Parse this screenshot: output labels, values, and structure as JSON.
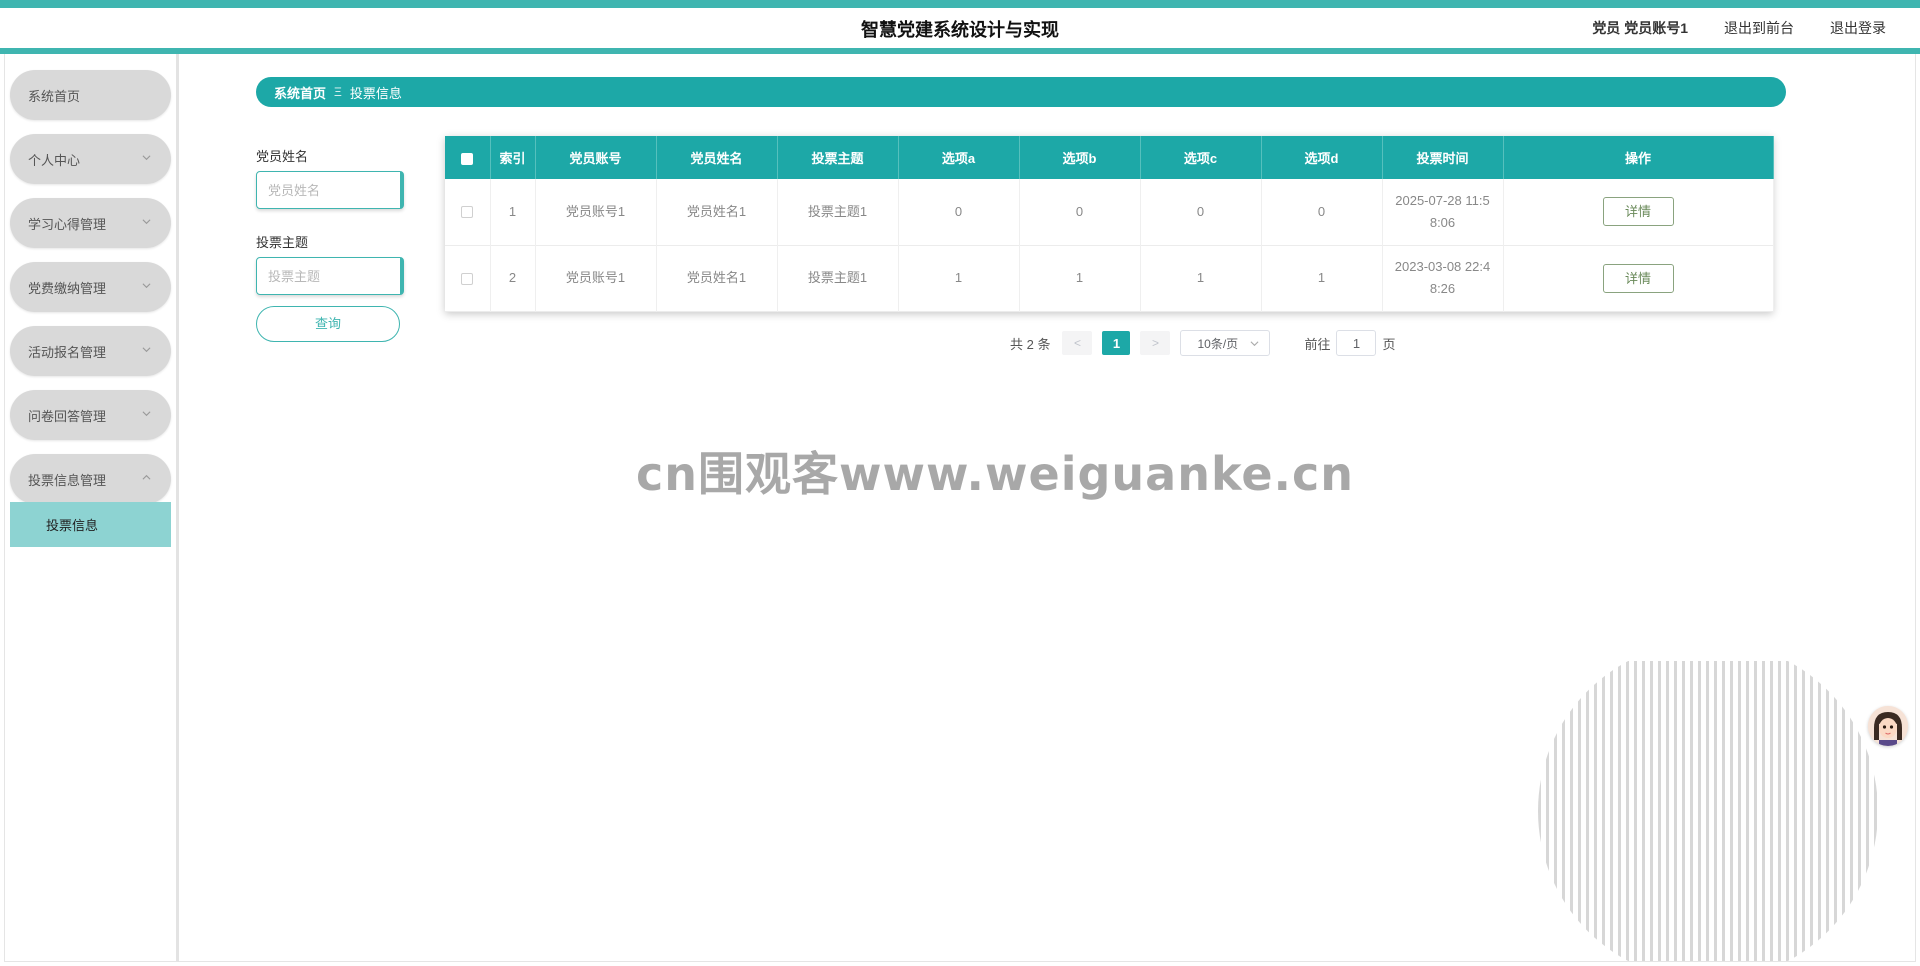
{
  "app": {
    "title": "智慧党建系统设计与实现",
    "user_label": "党员 党员账号1",
    "back_front": "退出到前台",
    "logout": "退出登录"
  },
  "sidebar": {
    "items": [
      {
        "label": "系统首页",
        "has_arrow": false
      },
      {
        "label": "个人中心",
        "has_arrow": true
      },
      {
        "label": "学习心得管理",
        "has_arrow": true
      },
      {
        "label": "党费缴纳管理",
        "has_arrow": true
      },
      {
        "label": "活动报名管理",
        "has_arrow": true
      },
      {
        "label": "问卷回答管理",
        "has_arrow": true
      },
      {
        "label": "投票信息管理",
        "has_arrow": true,
        "expanded": true
      }
    ],
    "submenu": {
      "label": "投票信息",
      "active": true
    }
  },
  "breadcrumb": {
    "home": "系统首页",
    "separator": "Ξ",
    "current": "投票信息"
  },
  "search": {
    "name_label": "党员姓名",
    "name_placeholder": "党员姓名",
    "topic_label": "投票主题",
    "topic_placeholder": "投票主题",
    "query_button": "查询"
  },
  "table": {
    "headers": [
      "索引",
      "党员账号",
      "党员姓名",
      "投票主题",
      "选项a",
      "选项b",
      "选项c",
      "选项d",
      "投票时间",
      "操作"
    ],
    "rows": [
      {
        "index": "1",
        "account": "党员账号1",
        "name": "党员姓名1",
        "topic": "投票主题1",
        "a": "0",
        "b": "0",
        "c": "0",
        "d": "0",
        "time_line1": "2025-07-28 11:5",
        "time_line2": "8:06",
        "action": "详情"
      },
      {
        "index": "2",
        "account": "党员账号1",
        "name": "党员姓名1",
        "topic": "投票主题1",
        "a": "1",
        "b": "1",
        "c": "1",
        "d": "1",
        "time_line1": "2023-03-08 22:4",
        "time_line2": "8:26",
        "action": "详情"
      }
    ]
  },
  "pagination": {
    "total": "共 2 条",
    "prev": "<",
    "current_page": "1",
    "next": ">",
    "page_size": "10条/页",
    "goto_label": "前往",
    "goto_value": "1",
    "page_suffix": "页"
  },
  "watermark": "cn围观客www.weiguanke.cn",
  "colors": {
    "accent": "#1da8a7",
    "accent_light": "#3fb5b0",
    "submenu_active": "#8dd3d2",
    "menu_bg": "#d9d9d9"
  }
}
